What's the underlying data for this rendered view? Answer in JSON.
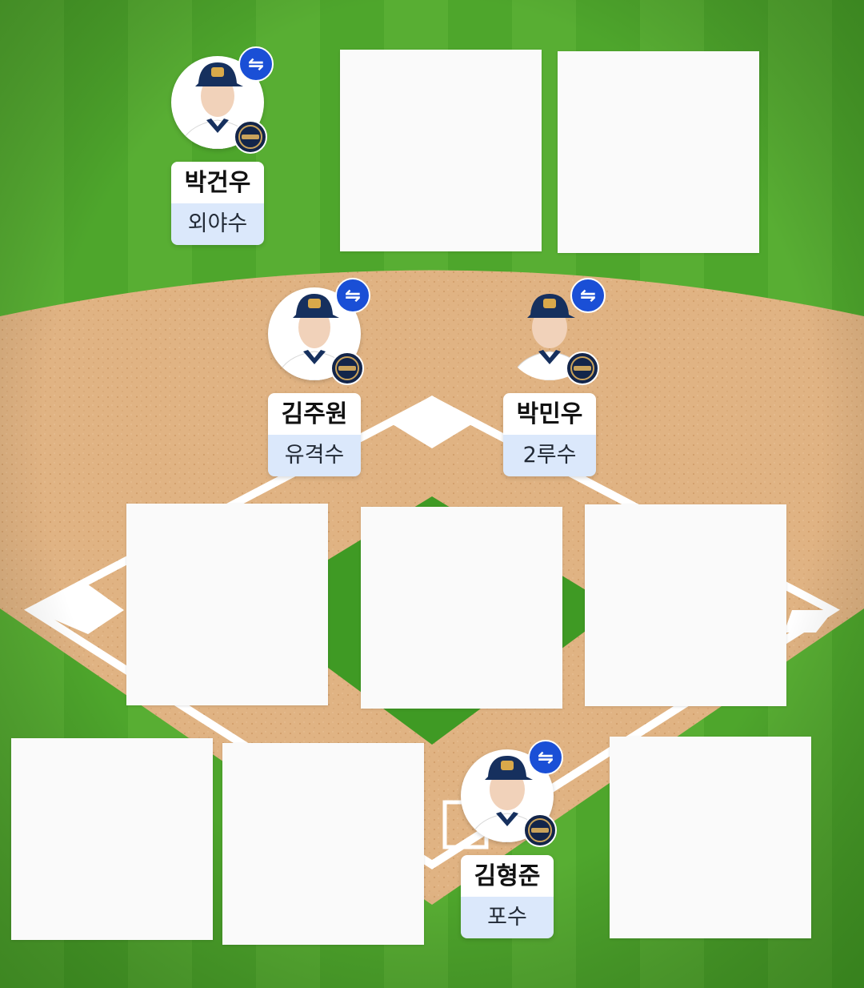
{
  "colors": {
    "grass_light": "#5fb538",
    "grass_dark": "#3d9622",
    "infield_dirt": "#e0b383",
    "base_lines": "#ffffff",
    "swap_button": "#1a4fd6",
    "position_bg": "#dbe8fb",
    "team_logo_bg": "#13254a",
    "placeholder": "#fafafa"
  },
  "icons": {
    "swap": "⇋",
    "team_logo": "dinos-logo-icon"
  },
  "players": [
    {
      "name": "박건우",
      "position": "외야수"
    },
    {
      "name": "김주원",
      "position": "유격수"
    },
    {
      "name": "박민우",
      "position": "2루수"
    },
    {
      "name": "김형준",
      "position": "포수"
    }
  ]
}
